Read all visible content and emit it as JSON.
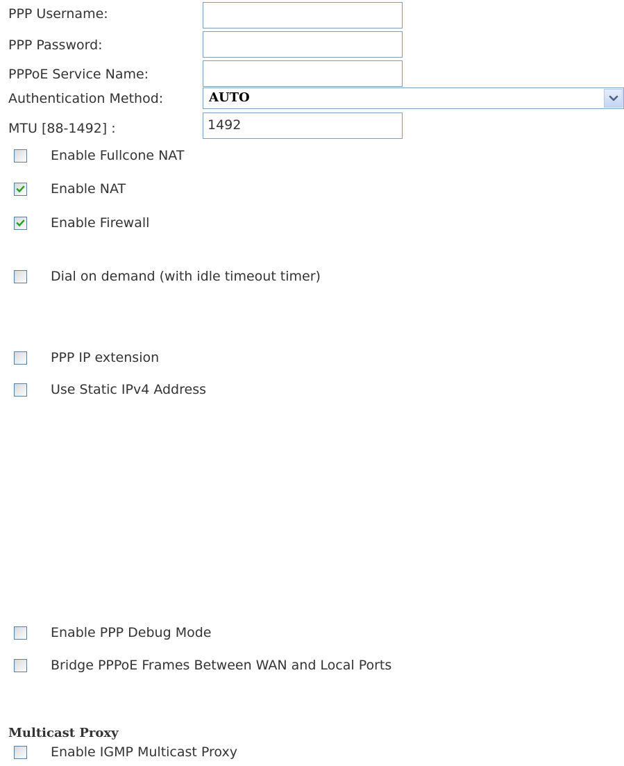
{
  "form": {
    "username": {
      "label": "PPP Username:",
      "value": ""
    },
    "password": {
      "label": "PPP Password:",
      "value": ""
    },
    "service_name": {
      "label": "PPPoE Service Name:",
      "value": ""
    },
    "auth_method": {
      "label": "Authentication Method:",
      "selected": "AUTO"
    },
    "mtu": {
      "label": "MTU [88-1492] :",
      "value": "1492"
    }
  },
  "options": [
    {
      "label": "Enable Fullcone NAT",
      "checked": false
    },
    {
      "label": "Enable NAT",
      "checked": true
    },
    {
      "label": "Enable Firewall",
      "checked": true
    },
    {
      "label": "Dial on demand (with idle timeout timer)",
      "checked": false
    },
    {
      "label": "PPP IP extension",
      "checked": false
    },
    {
      "label": "Use Static IPv4 Address",
      "checked": false
    },
    {
      "label": "Enable PPP Debug Mode",
      "checked": false
    },
    {
      "label": "Bridge PPPoE Frames Between WAN and Local Ports",
      "checked": false
    }
  ],
  "multicast": {
    "title": "Multicast Proxy",
    "options": [
      {
        "label": "Enable IGMP Multicast Proxy",
        "checked": false
      }
    ]
  },
  "colors": {
    "text": "#333333",
    "field_border": "#7f9db9",
    "check_mark": "#21a121"
  },
  "icons": {
    "select_arrow": "chevron-down-icon",
    "check": "checkmark-icon"
  }
}
